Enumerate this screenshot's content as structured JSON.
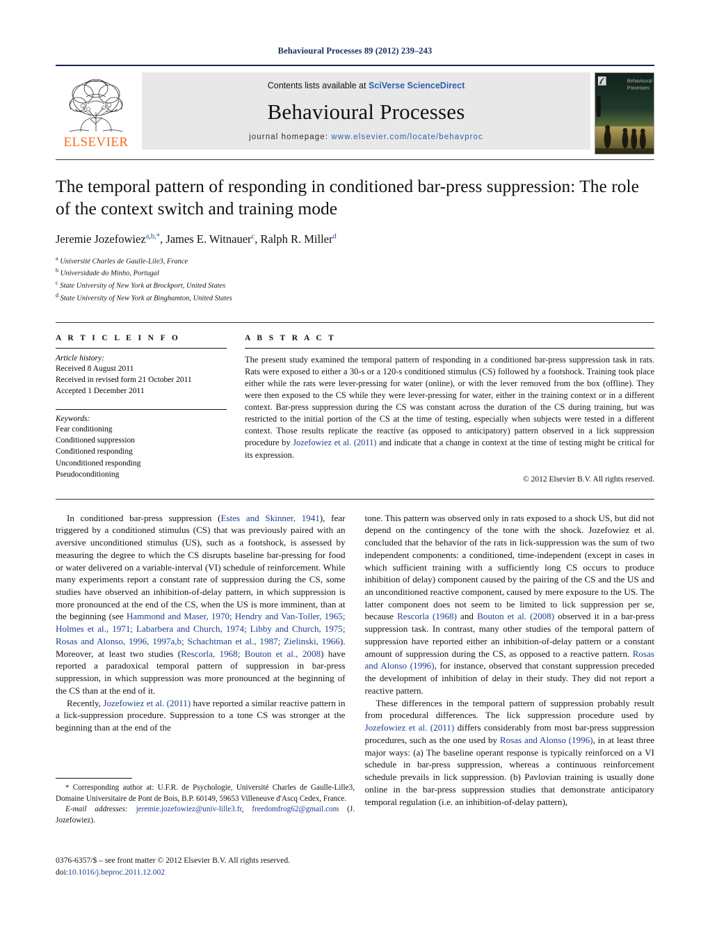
{
  "running_head": "Behavioural Processes 89 (2012) 239–243",
  "masthead": {
    "contents_prefix": "Contents lists available at ",
    "contents_link": "SciVerse ScienceDirect",
    "journal_title": "Behavioural Processes",
    "homepage_prefix": "journal homepage:",
    "homepage_url": "www.elsevier.com/locate/behavproc",
    "publisher_wordmark": "ELSEVIER",
    "cover_title_line1": "Behavioural",
    "cover_title_line2": "Processes",
    "link_color": "#2b5fb0"
  },
  "article": {
    "title": "The temporal pattern of responding in conditioned bar-press suppression: The role of the context switch and training mode",
    "authors_html": "Jeremie Jozefowiez<sup>a,b,*</sup>, James E. Witnauer<sup>c</sup>, Ralph R. Miller<sup>d</sup>",
    "affiliations": [
      {
        "marker": "a",
        "text": "Université Charles de Gaulle-Lile3, France"
      },
      {
        "marker": "b",
        "text": "Universidade do Minho, Portugal"
      },
      {
        "marker": "c",
        "text": "State University of New York at Brockport, United States"
      },
      {
        "marker": "d",
        "text": "State University of New York at Binghamton, United States"
      }
    ]
  },
  "article_info": {
    "heading": "A R T I C L E   I N F O",
    "history_label": "Article history:",
    "history": [
      "Received 8 August 2011",
      "Received in revised form 21 October 2011",
      "Accepted 1 December 2011"
    ],
    "keywords_label": "Keywords:",
    "keywords": [
      "Fear conditioning",
      "Conditioned suppression",
      "Conditioned responding",
      "Unconditioned responding",
      "Pseudoconditioning"
    ]
  },
  "abstract": {
    "heading": "A B S T R A C T",
    "text_html": "The present study examined the temporal pattern of responding in a conditioned bar-press suppression task in rats. Rats were exposed to either a 30-s or a 120-s conditioned stimulus (CS) followed by a footshock. Training took place either while the rats were lever-pressing for water (online), or with the lever removed from the box (offline). They were then exposed to the CS while they were lever-pressing for water, either in the training context or in a different context. Bar-press suppression during the CS was constant across the duration of the CS during training, but was restricted to the initial portion of the CS at the time of testing, especially when subjects were tested in a different context. Those results replicate the reactive (as opposed to anticipatory) pattern observed in a lick suppression procedure by <span class=\"ref\">Jozefowiez et al. (2011)</span> and indicate that a change in context at the time of testing might be critical for its expression.",
    "copyright": "© 2012 Elsevier B.V. All rights reserved."
  },
  "body": {
    "left_paragraphs_html": [
      "In conditioned bar-press suppression (<span class=\"ref\">Estes and Skinner, 1941</span>), fear triggered by a conditioned stimulus (CS) that was previously paired with an aversive unconditioned stimulus (US), such as a footshock, is assessed by measuring the degree to which the CS disrupts baseline bar-pressing for food or water delivered on a variable-interval (VI) schedule of reinforcement. While many experiments report a constant rate of suppression during the CS, some studies have observed an inhibition-of-delay pattern, in which suppression is more pronounced at the end of the CS, when the US is more imminent, than at the beginning (see <span class=\"ref\">Hammond and Maser, 1970; Hendry and Van-Toller, 1965; Holmes et al., 1971; Labarbera and Church, 1974; Libby and Church, 1975; Rosas and Alonso, 1996, 1997a,b; Schachtman et al., 1987; Zielinski, 1966</span>). Moreover, at least two studies (<span class=\"ref\">Rescorla, 1968; Bouton et al., 2008</span>) have reported a paradoxical temporal pattern of suppression in bar-press suppression, in which suppression was more pronounced at the beginning of the CS than at the end of it.",
      "Recently, <span class=\"ref\">Jozefowiez et al. (2011)</span> have reported a similar reactive pattern in a lick-suppression procedure. Suppression to a tone CS was stronger at the beginning than at the end of the"
    ],
    "right_paragraphs_html": [
      "tone. This pattern was observed only in rats exposed to a shock US, but did not depend on the contingency of the tone with the shock. Jozefowiez et al. concluded that the behavior of the rats in lick-suppression was the sum of two independent components: a conditioned, time-independent (except in cases in which sufficient training with a sufficiently long CS occurs to produce inhibition of delay) component caused by the pairing of the CS and the US and an unconditioned reactive component, caused by mere exposure to the US. The latter component does not seem to be limited to lick suppression per se, because <span class=\"ref\">Rescorla (1968)</span> and <span class=\"ref\">Bouton et al. (2008)</span> observed it in a bar-press suppression task. In contrast, many other studies of the temporal pattern of suppression have reported either an inhibition-of-delay pattern or a constant amount of suppression during the CS, as opposed to a reactive pattern. <span class=\"ref\">Rosas and Alonso (1996)</span>, for instance, observed that constant suppression preceded the development of inhibition of delay in their study. They did not report a reactive pattern.",
      "These differences in the temporal pattern of suppression probably result from procedural differences. The lick suppression procedure used by <span class=\"ref\">Jozefowiez et al. (2011)</span> differs considerably from most bar-press suppression procedures, such as the one used by <span class=\"ref\">Rosas and Alonso (1996)</span>, in at least three major ways: (a) The baseline operant response is typically reinforced on a VI schedule in bar-press suppression, whereas a continuous reinforcement schedule prevails in lick suppression. (b) Pavlovian training is usually done online in the bar-press suppression studies that demonstrate anticipatory temporal regulation (i.e. an inhibition-of-delay pattern),"
    ]
  },
  "footnote": {
    "corresponding_html": "<span class=\"star\">*</span> Corresponding author at: U.F.R. de Psychologie, Université Charles de Gaulle-Lille3, Domaine Universitaire de Pont de Bois, B.P. 60149, 59653 Villeneuve d'Ascq Cedex, France.",
    "emails_html": "<span class=\"fn-email\">E-mail addresses:</span> <a href=\"#\">jeremie.jozefowiez@univ-lille3.fr</a>, <a href=\"#\">freedomfrog62@gmail.com</a> (J. Jozefowiez)."
  },
  "imprint": {
    "issn_line": "0376-6357/$ – see front matter © 2012 Elsevier B.V. All rights reserved.",
    "doi_prefix": "doi:",
    "doi": "10.1016/j.beproc.2011.12.002"
  }
}
